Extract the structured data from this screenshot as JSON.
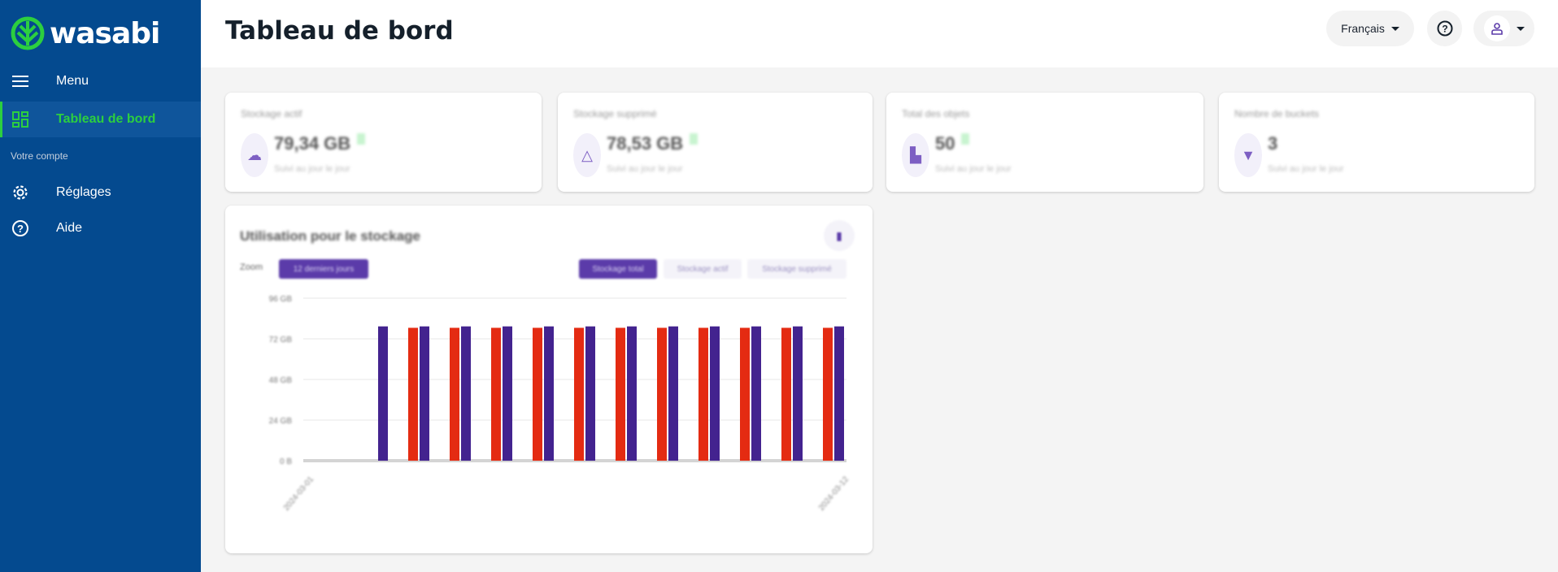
{
  "sidebar": {
    "brand": "wasabi",
    "menu_label": "Menu",
    "items": [
      {
        "label": "Tableau de bord",
        "icon": "dashboard-icon",
        "active": true
      },
      {
        "label": "Réglages",
        "icon": "gear-icon"
      },
      {
        "label": "Aide",
        "icon": "help-circle-icon"
      }
    ],
    "section_label": "Votre compte"
  },
  "header": {
    "title": "Tableau de bord",
    "language": "Français",
    "help_icon": "help-circle-icon",
    "user_icon": "user-icon"
  },
  "stats": [
    {
      "title": "Stockage actif",
      "value": "79,34 GB",
      "sub": "Suivi au jour le jour",
      "icon": "cloud-icon"
    },
    {
      "title": "Stockage supprimé",
      "value": "78,53 GB",
      "sub": "Suivi au jour le jour",
      "icon": "cloud-delete-icon"
    },
    {
      "title": "Total des objets",
      "value": "50",
      "sub": "Suivi au jour le jour",
      "icon": "file-icon"
    },
    {
      "title": "Nombre de buckets",
      "value": "3",
      "sub": "Suivi au jour le jour",
      "icon": "bucket-icon"
    }
  ],
  "usage": {
    "title": "Utilisation pour le stockage",
    "zoom_label": "Zoom",
    "zoom_value": "12 derniers jours",
    "toggles": [
      {
        "label": "Stockage total",
        "active": true
      },
      {
        "label": "Stockage actif",
        "active": false
      },
      {
        "label": "Stockage supprimé",
        "active": false
      }
    ]
  },
  "colors": {
    "sidebar": "#044a8f",
    "accent": "#2ccf3f",
    "purple": "#43238f",
    "red": "#e42b12"
  },
  "chart_data": {
    "type": "bar",
    "ylim": [
      0,
      96
    ],
    "yticks": [
      "0 B",
      "24 GB",
      "48 GB",
      "72 GB",
      "96 GB"
    ],
    "xlabels_shown": [
      "2024-03-01",
      "2024-03-12"
    ],
    "categories": [
      "1",
      "2",
      "3",
      "4",
      "5",
      "6",
      "7",
      "8",
      "9",
      "10",
      "11",
      "12"
    ],
    "series": [
      {
        "color": "#e42b12",
        "values": [
          0,
          78.5,
          78.5,
          78.5,
          78.5,
          78.5,
          78.5,
          78.5,
          78.5,
          78.5,
          78.5,
          78.5
        ]
      },
      {
        "color": "#43238f",
        "values": [
          79.34,
          79.34,
          79.34,
          79.34,
          79.34,
          79.34,
          79.34,
          79.34,
          79.34,
          79.34,
          79.34,
          79.34
        ]
      }
    ],
    "grid": true
  }
}
